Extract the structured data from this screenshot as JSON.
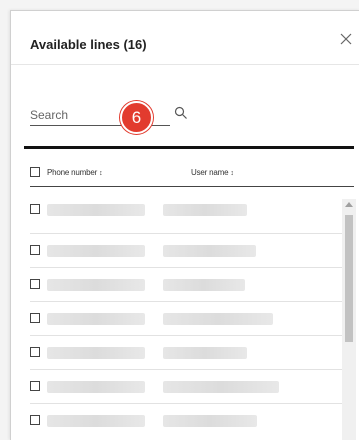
{
  "dialog": {
    "title": "Available lines (16)",
    "close_icon": "close-icon"
  },
  "search": {
    "placeholder": "Search",
    "value": "",
    "icon": "search-icon"
  },
  "step_badge": {
    "number": "6",
    "color": "#e23b2e"
  },
  "table": {
    "columns": [
      {
        "label": "Phone number",
        "sort_icon": "sort-icon"
      },
      {
        "label": "User name",
        "sort_icon": "sort-icon"
      }
    ],
    "rows_note": "",
    "rows": [
      {
        "checked": false
      },
      {
        "checked": false
      },
      {
        "checked": false
      },
      {
        "checked": false
      },
      {
        "checked": false
      },
      {
        "checked": false
      },
      {
        "checked": false
      }
    ]
  }
}
